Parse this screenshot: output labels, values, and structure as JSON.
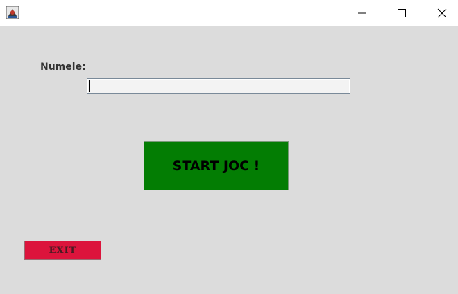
{
  "window": {
    "icon": "java-app-icon",
    "controls": {
      "minimize_icon": "minimize-icon",
      "maximize_icon": "maximize-icon",
      "close_icon": "close-icon"
    },
    "background": "#dcdcdc"
  },
  "form": {
    "name_label": "Numele:",
    "name_value": "",
    "name_placeholder": ""
  },
  "buttons": {
    "start_label": "START JOC !",
    "start_color": "#037d03",
    "exit_label": "EXIT",
    "exit_color": "#dc143c"
  }
}
